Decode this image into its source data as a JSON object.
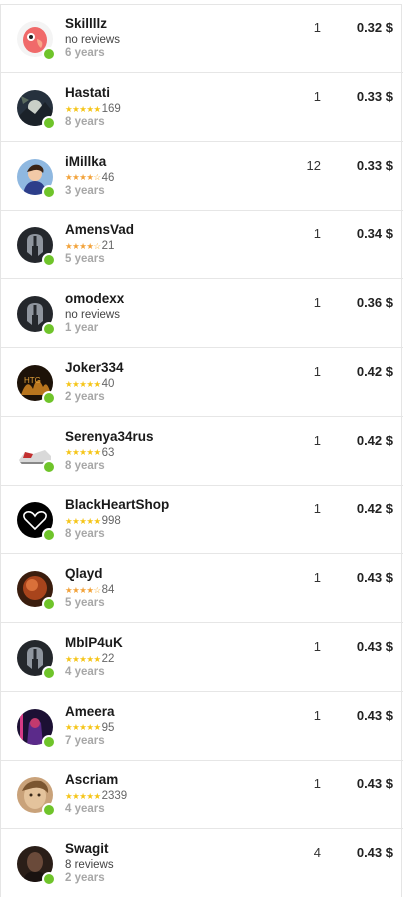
{
  "currency_symbol": "$",
  "colors": {
    "online": "#6fc42a",
    "star": "#f5c518",
    "star_partial": "#f2a23a",
    "age_text": "#a7a7a7",
    "divider": "#e6e6e6"
  },
  "sellers": [
    {
      "name": "Skillllz",
      "reviews_text": "no reviews",
      "stars": 0,
      "review_count": "",
      "age": "6 years",
      "quantity": "1",
      "price": "0.32 $",
      "avatar": "parrot-avatar",
      "online": true
    },
    {
      "name": "Hastati",
      "reviews_text": "",
      "stars": 5,
      "review_count": "169",
      "age": "8 years",
      "quantity": "1",
      "price": "0.33 $",
      "avatar": "dark-landscape-avatar",
      "online": true
    },
    {
      "name": "iMillka",
      "reviews_text": "",
      "stars": 4,
      "review_count": "46",
      "age": "3 years",
      "quantity": "12",
      "price": "0.33 $",
      "avatar": "anime-character-avatar",
      "online": true
    },
    {
      "name": "AmensVad",
      "reviews_text": "",
      "stars": 4,
      "review_count": "21",
      "age": "5 years",
      "quantity": "1",
      "price": "0.34 $",
      "avatar": "default-helmet-avatar",
      "online": true
    },
    {
      "name": "omodexx",
      "reviews_text": "no reviews",
      "stars": 0,
      "review_count": "",
      "age": "1 year",
      "quantity": "1",
      "price": "0.36 $",
      "avatar": "default-helmet-avatar",
      "online": true
    },
    {
      "name": "Joker334",
      "reviews_text": "",
      "stars": 5,
      "review_count": "40",
      "age": "2 years",
      "quantity": "1",
      "price": "0.42 $",
      "avatar": "dark-fire-avatar",
      "online": true
    },
    {
      "name": "Serenya34rus",
      "reviews_text": "",
      "stars": 5,
      "review_count": "63",
      "age": "8 years",
      "quantity": "1",
      "price": "0.42 $",
      "avatar": "sneaker-avatar",
      "online": true
    },
    {
      "name": "BlackHeartShop",
      "reviews_text": "",
      "stars": 5,
      "review_count": "998",
      "age": "8 years",
      "quantity": "1",
      "price": "0.42 $",
      "avatar": "black-heart-avatar",
      "online": true
    },
    {
      "name": "Qlayd",
      "reviews_text": "",
      "stars": 4,
      "review_count": "84",
      "age": "5 years",
      "quantity": "1",
      "price": "0.43 $",
      "avatar": "orange-blur-avatar",
      "online": true
    },
    {
      "name": "MblP4uK",
      "reviews_text": "",
      "stars": 5,
      "review_count": "22",
      "age": "4 years",
      "quantity": "1",
      "price": "0.43 $",
      "avatar": "default-helmet-avatar",
      "online": true
    },
    {
      "name": "Ameera",
      "reviews_text": "",
      "stars": 5,
      "review_count": "95",
      "age": "7 years",
      "quantity": "1",
      "price": "0.43 $",
      "avatar": "neon-character-avatar",
      "online": true
    },
    {
      "name": "Ascriam",
      "reviews_text": "",
      "stars": 5,
      "review_count": "2339",
      "age": "4 years",
      "quantity": "1",
      "price": "0.43 $",
      "avatar": "face-avatar",
      "online": true
    },
    {
      "name": "Swagit",
      "reviews_text": "8 reviews",
      "stars": 0,
      "review_count": "",
      "age": "2 years",
      "quantity": "4",
      "price": "0.43 $",
      "avatar": "dark-portrait-avatar",
      "online": true
    }
  ]
}
